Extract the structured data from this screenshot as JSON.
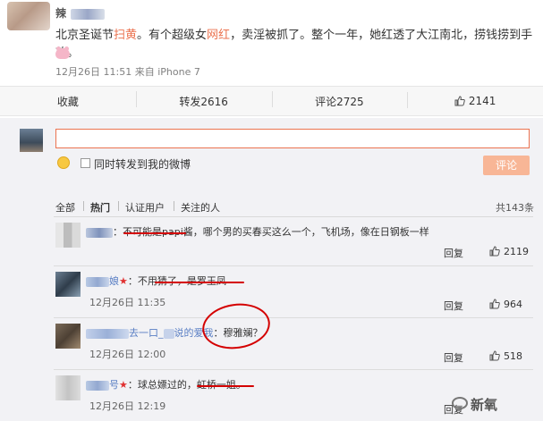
{
  "post": {
    "author": "辣",
    "text_plain_1": "北京圣诞节",
    "text_highlight_1": "扫黄",
    "text_plain_2": "。有个超级女",
    "text_highlight_2": "网红",
    "text_plain_3": "，卖淫被抓了。整个一年，她红透了大江南北，捞钱捞到手软。",
    "time": "12月26日 11:51",
    "source_prefix": "来自",
    "source": "iPhone 7"
  },
  "actions": {
    "collect": "收藏",
    "repost": "转发2616",
    "comment": "评论2725",
    "like": "2141"
  },
  "composer": {
    "input_value": "",
    "repost_label": "同时转发到我的微博",
    "submit_label": "评论"
  },
  "filters": {
    "all": "全部",
    "hot": "热门",
    "verified": "认证用户",
    "following": "关注的人",
    "total": "共143条"
  },
  "comments": [
    {
      "text_a": "：",
      "text_red": "不可能是papi酱",
      "text_b": "，哪个男的买春买这么一个，飞机场，像在日钢板一样",
      "time": "",
      "reply": "回复",
      "likes": "2119"
    },
    {
      "name_tail": "娘",
      "text_a": "：",
      "text_red": "不用猜了，是罗玉凤",
      "text_b": "",
      "time": "12月26日 11:35",
      "reply": "回复",
      "likes": "964"
    },
    {
      "name_link_a": "去一口_",
      "name_link_b": "说的爱我",
      "text_a": "：",
      "text_red": "穆雅斓？",
      "text_b": "",
      "time": "12月26日 12:00",
      "reply": "回复",
      "likes": "518"
    },
    {
      "name_tail": "号",
      "text_a": "：球总嫖过的，",
      "text_red": "虹桥一姐",
      "text_b": "。",
      "time": "12月26日 12:19",
      "reply": "回复",
      "likes": ""
    }
  ],
  "watermark": "新氧",
  "colors": {
    "highlight": "#eb7350",
    "annotation_red": "#d40000",
    "link": "#5a7fc4",
    "submit_bg": "#f8b696"
  }
}
